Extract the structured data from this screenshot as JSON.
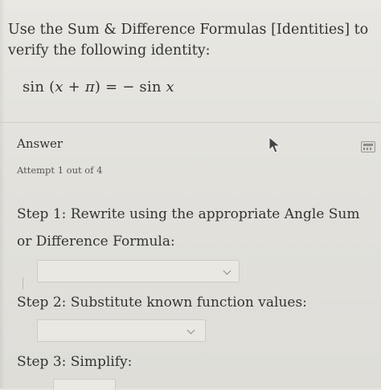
{
  "question": {
    "title": "Use the Sum & Difference Formulas [Identities] to verify the following identity:",
    "identity_parts": {
      "lhs_func": "sin",
      "open": " (",
      "x": "x",
      "plus": " + ",
      "pi": "π",
      "close_eq": ") = − sin ",
      "x2": "x"
    }
  },
  "answer": {
    "label": "Answer",
    "attempt": "Attempt 1 out of 4"
  },
  "steps": [
    {
      "label": "Step 1: Rewrite using the appropriate Angle Sum or Difference Formula:",
      "selected_value": ""
    },
    {
      "label": "Step 2: Substitute known function values:",
      "selected_value": ""
    },
    {
      "label": "Step 3: Simplify:",
      "selected_value": ""
    }
  ],
  "icons": {
    "calculator": "calculator-icon",
    "cursor": "mouse-pointer-icon",
    "dropdown": "chevron-down-icon"
  }
}
